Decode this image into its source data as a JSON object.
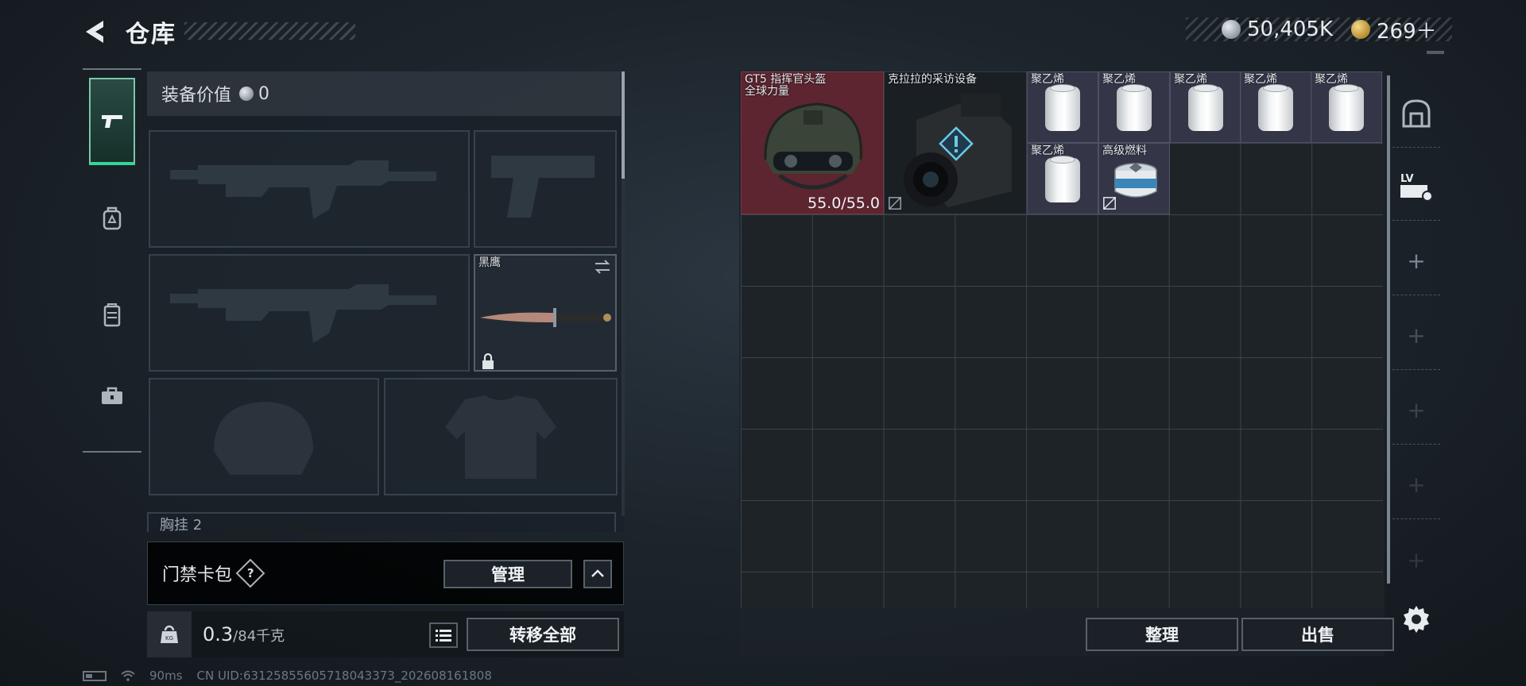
{
  "header": {
    "title": "仓库",
    "currencies": [
      {
        "value": "50,405K",
        "icon": "silver-coin-icon"
      },
      {
        "value": "269＋",
        "icon": "gold-coin-icon"
      }
    ]
  },
  "rail_tabs": [
    {
      "name": "weapons",
      "icon": "pistol-icon",
      "active": true
    },
    {
      "name": "medical",
      "icon": "backpack-icon",
      "active": false
    },
    {
      "name": "gear",
      "icon": "vest-icon",
      "active": false
    },
    {
      "name": "toolbox",
      "icon": "toolbox-icon",
      "active": false
    }
  ],
  "equipment": {
    "value_label": "装备价值",
    "value": "0",
    "knife_name": "黑鹰",
    "chest_label": "胸挂",
    "chest_count": "2"
  },
  "keycard": {
    "label": "门禁卡包",
    "help": "?",
    "manage_label": "管理"
  },
  "weight": {
    "current": "0.3",
    "max": "/84千克",
    "transfer_label": "转移全部"
  },
  "stash": {
    "items": [
      {
        "name": "GT5 指挥官头盔\n全球力量",
        "durability": "55.0/55.0"
      },
      {
        "name": "克拉拉的采访设备"
      },
      {
        "name": "聚乙烯"
      },
      {
        "name": "聚乙烯"
      },
      {
        "name": "聚乙烯"
      },
      {
        "name": "聚乙烯"
      },
      {
        "name": "聚乙烯"
      },
      {
        "name": "聚乙烯"
      },
      {
        "name": "高级燃料"
      }
    ],
    "sort_label": "整理",
    "sell_label": "出售"
  },
  "right_rail": {
    "level_badge": "LV"
  },
  "status": {
    "ping": "90ms",
    "uid": "CN UID:6312585560571804337­3_202608161808"
  },
  "colors": {
    "accent_green": "#37d49a",
    "helmet_bg": "#6b2a33",
    "poly_bg": "#3c3e52"
  }
}
